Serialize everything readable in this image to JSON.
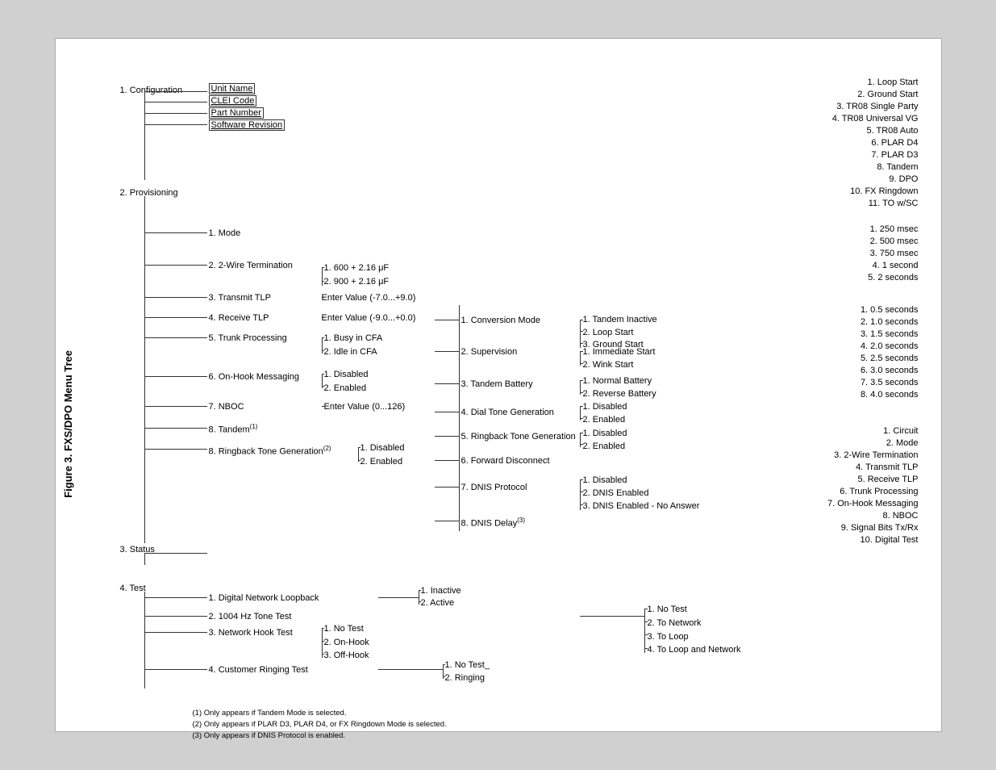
{
  "figure_label": "Figure 3.  FXS/DPO Menu Tree",
  "sections": {
    "configuration": {
      "label": "1. Configuration",
      "items": [
        "Unit Name",
        "CLEI Code",
        "Part Number",
        "Software Revision"
      ]
    },
    "provisioning": {
      "label": "2. Provisioning",
      "mode": "1. Mode",
      "items": [
        {
          "label": "2. 2-Wire Termination",
          "sub": [
            "1. 600 + 2.16 μF",
            "2. 900 + 2.16 μF"
          ]
        },
        {
          "label": "3. Transmit TLP",
          "sub": [
            "Enter Value (-7.0...+9.0)"
          ]
        },
        {
          "label": "4. Receive TLP",
          "sub": [
            "Enter Value (-9.0...+0.0)"
          ]
        },
        {
          "label": "5. Trunk Processing",
          "sub": [
            "1. Busy in CFA",
            "2. Idle in CFA"
          ]
        },
        {
          "label": "6. On-Hook Messaging",
          "sub": [
            "1. Disabled",
            "2. Enabled"
          ]
        },
        {
          "label": "7. NBOC",
          "sub": [
            "Enter Value (0...126)"
          ]
        },
        {
          "label": "8. Tandem(1)"
        },
        {
          "label": "8. Ringback Tone Generation(2)",
          "sub": [
            "1. Disabled",
            "2. Enabled"
          ]
        }
      ]
    },
    "conversion": {
      "label": "1. Conversion Mode",
      "sub": [
        "1. Tandem Inactive",
        "2. Loop Start",
        "3. Ground Start"
      ]
    },
    "supervision": {
      "label": "2. Supervision",
      "sub": [
        "1. Immediate Start",
        "2. Wink Start"
      ]
    },
    "tandem_battery": {
      "label": "3. Tandem Battery",
      "sub": [
        "1. Normal Battery",
        "2. Reverse Battery"
      ]
    },
    "dial_tone": {
      "label": "4. Dial Tone Generation",
      "sub": [
        "1. Disabled",
        "2. Enabled"
      ]
    },
    "ringback": {
      "label": "5. Ringback Tone Generation",
      "sub": [
        "1. Disabled",
        "2. Enabled"
      ]
    },
    "forward_disconnect": {
      "label": "6. Forward Disconnect"
    },
    "dnis": {
      "label": "7. DNIS Protocol",
      "sub": [
        "1. Disabled",
        "2. DNIS Enabled",
        "3. DNIS Enabled - No Answer"
      ]
    },
    "dnis_delay": {
      "label": "8. DNIS Delay(3)"
    },
    "status": {
      "label": "3. Status"
    },
    "test": {
      "label": "4. Test",
      "items": [
        {
          "label": "1. Digital Network Loopback"
        },
        {
          "label": "2. 1004 Hz Tone Test"
        },
        {
          "label": "3. Network Hook Test",
          "sub": [
            "1. No Test",
            "2. On-Hook",
            "3. Off-Hook"
          ]
        },
        {
          "label": "4. Customer Ringing Test"
        }
      ]
    },
    "test_inactive": {
      "label": "1. Inactive"
    },
    "test_active": {
      "label": "2. Active"
    },
    "test_no_test": {
      "label": "1. No Test_"
    },
    "test_ringing": {
      "label": "2. Ringing"
    },
    "network_results": {
      "sub": [
        "1. No Test",
        "2. To Network",
        "3. To Loop",
        "4. To Loop and Network"
      ]
    },
    "right_col1": {
      "items": [
        "1. Loop Start",
        "2. Ground Start",
        "3. TR08 Single Party",
        "4. TR08 Universal VG",
        "5. TR08 Auto",
        "6. PLAR D4",
        "7. PLAR D3",
        "8. Tandem",
        "9. DPO",
        "10. FX Ringdown",
        "11. TO w/SC"
      ]
    },
    "right_col2": {
      "items": [
        "1. 250 msec",
        "2. 500 msec",
        "3. 750 msec",
        "4. 1 second",
        "5. 2 seconds"
      ]
    },
    "right_col3": {
      "items": [
        "1. 0.5 seconds",
        "2. 1.0 seconds",
        "3. 1.5 seconds",
        "4. 2.0 seconds",
        "5. 2.5 seconds",
        "6. 3.0 seconds",
        "7. 3.5 seconds",
        "8. 4.0 seconds"
      ]
    },
    "right_col4": {
      "items": [
        "1. Circuit",
        "2. Mode",
        "3. 2-Wire Termination",
        "4. Transmit TLP",
        "5. Receive TLP",
        "6. Trunk Processing",
        "7. On-Hook Messaging",
        "8. NBOC",
        "9. Signal Bits Tx/Rx",
        "10. Digital Test"
      ]
    },
    "footnotes": {
      "1": "(1) Only appears if Tandem Mode is selected.",
      "2": "(2) Only appears if PLAR D3, PLAR D4, or FX Ringdown Mode is selected.",
      "3": "(3) Only appears if DNIS Protocol is enabled."
    }
  }
}
